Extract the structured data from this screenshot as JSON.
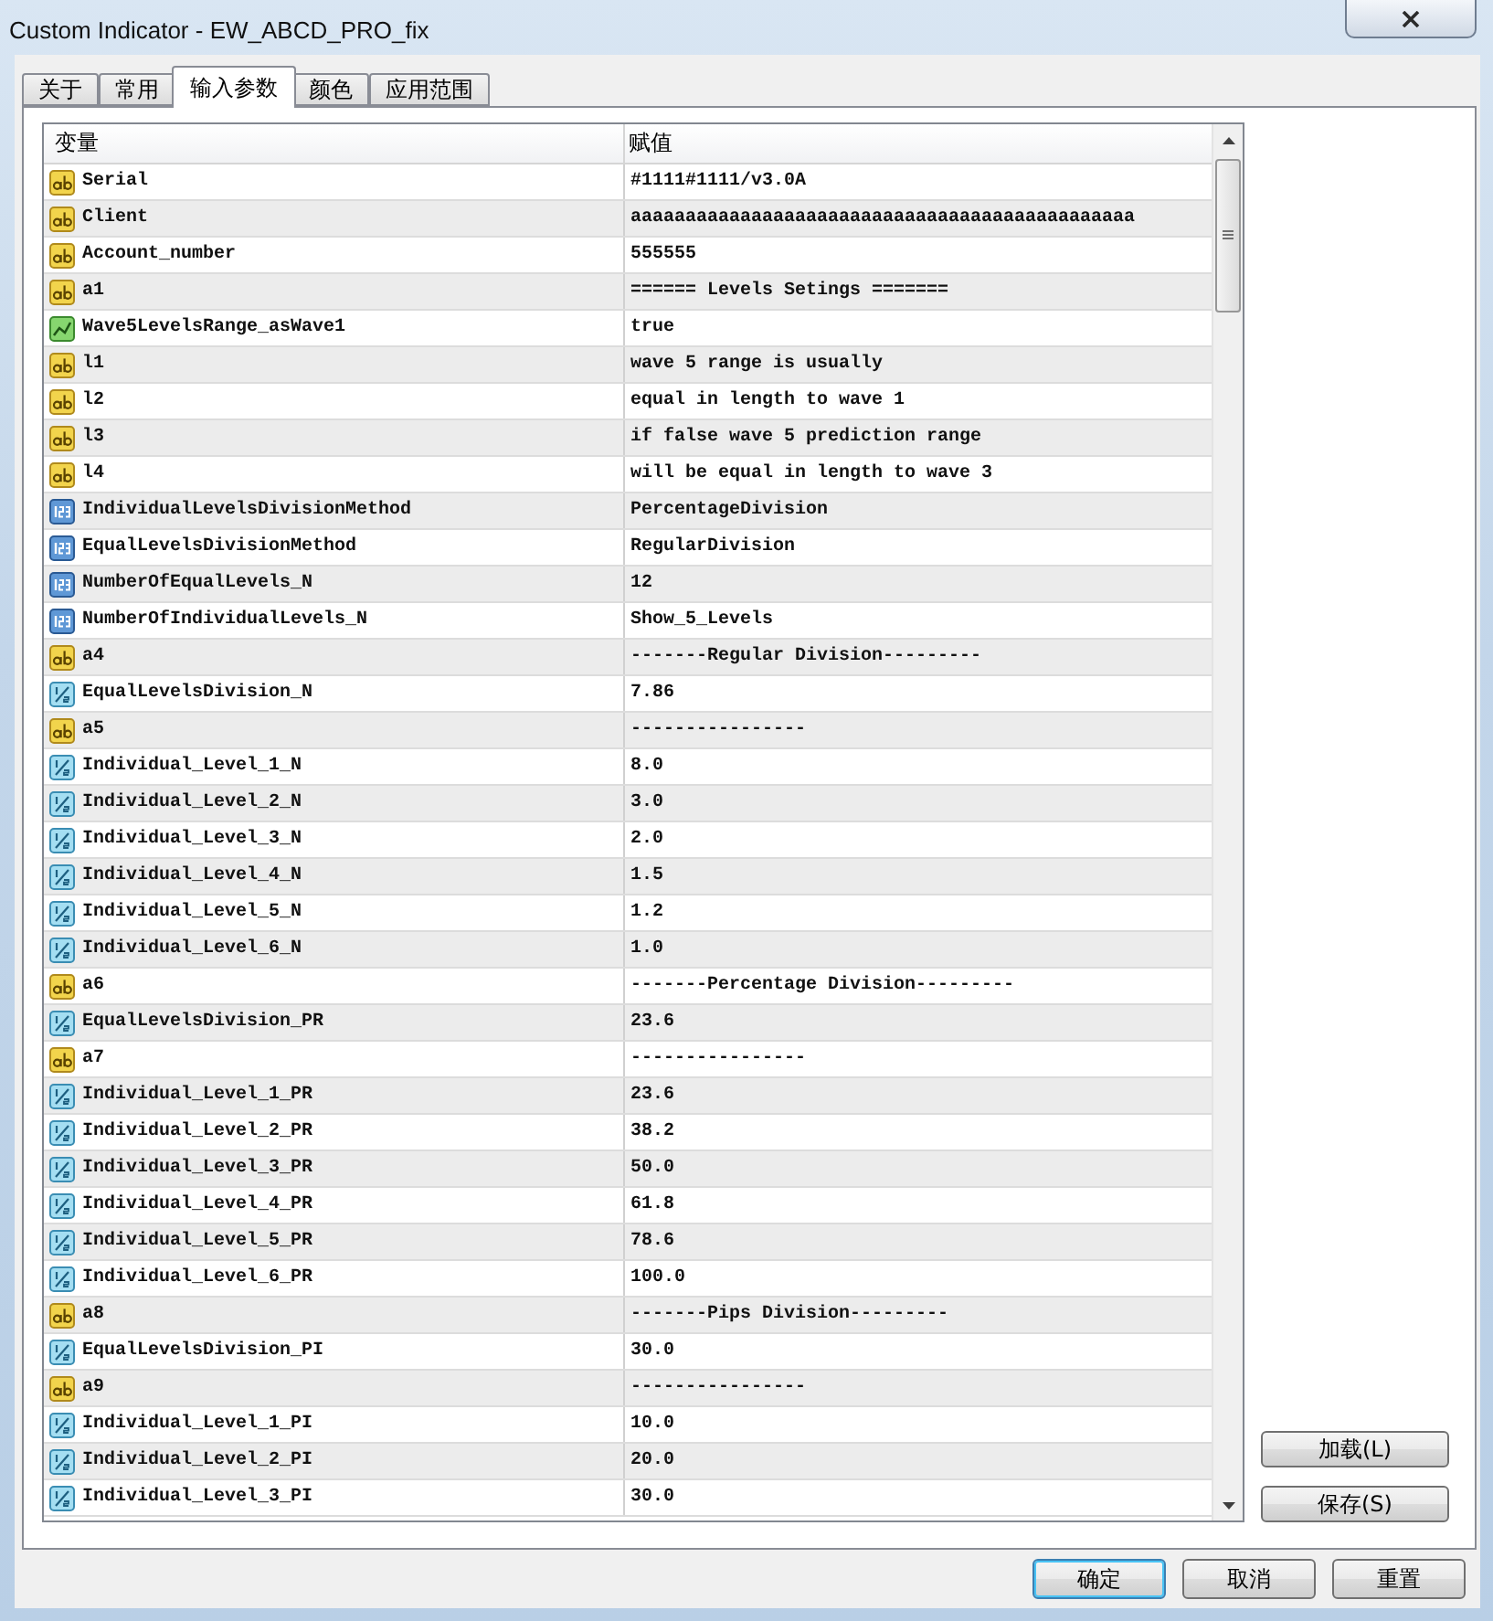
{
  "window": {
    "title": "Custom Indicator - EW_ABCD_PRO_fix"
  },
  "tabs": [
    {
      "label": "关于",
      "selected": false
    },
    {
      "label": "常用",
      "selected": false
    },
    {
      "label": "输入参数",
      "selected": true
    },
    {
      "label": "颜色",
      "selected": false
    },
    {
      "label": "应用范围",
      "selected": false
    }
  ],
  "table": {
    "columns": [
      "变量",
      "赋值"
    ],
    "rows": [
      {
        "kind": "string",
        "variable": "Serial",
        "value": "#1111#1111/v3.0A"
      },
      {
        "kind": "string",
        "variable": "Client",
        "value": "aaaaaaaaaaaaaaaaaaaaaaaaaaaaaaaaaaaaaaaaaaaaaa"
      },
      {
        "kind": "string",
        "variable": "Account_number",
        "value": "555555"
      },
      {
        "kind": "string",
        "variable": "a1",
        "value": "====== Levels Setings ======="
      },
      {
        "kind": "bool",
        "variable": "Wave5LevelsRange_asWave1",
        "value": "true"
      },
      {
        "kind": "string",
        "variable": "l1",
        "value": "wave 5 range is usually"
      },
      {
        "kind": "string",
        "variable": "l2",
        "value": "equal in length to wave 1"
      },
      {
        "kind": "string",
        "variable": "l3",
        "value": "if false wave 5 prediction range"
      },
      {
        "kind": "string",
        "variable": "l4",
        "value": "will be equal in length to wave 3"
      },
      {
        "kind": "int",
        "variable": "IndividualLevelsDivisionMethod",
        "value": "PercentageDivision"
      },
      {
        "kind": "int",
        "variable": "EqualLevelsDivisionMethod",
        "value": "RegularDivision"
      },
      {
        "kind": "int",
        "variable": "NumberOfEqualLevels_N",
        "value": "12"
      },
      {
        "kind": "int",
        "variable": "NumberOfIndividualLevels_N",
        "value": "Show_5_Levels"
      },
      {
        "kind": "string",
        "variable": "a4",
        "value": "-------Regular Division---------"
      },
      {
        "kind": "double",
        "variable": "EqualLevelsDivision_N",
        "value": "7.86"
      },
      {
        "kind": "string",
        "variable": "a5",
        "value": "----------------"
      },
      {
        "kind": "double",
        "variable": "Individual_Level_1_N",
        "value": "8.0"
      },
      {
        "kind": "double",
        "variable": "Individual_Level_2_N",
        "value": "3.0"
      },
      {
        "kind": "double",
        "variable": "Individual_Level_3_N",
        "value": "2.0"
      },
      {
        "kind": "double",
        "variable": "Individual_Level_4_N",
        "value": "1.5"
      },
      {
        "kind": "double",
        "variable": "Individual_Level_5_N",
        "value": "1.2"
      },
      {
        "kind": "double",
        "variable": "Individual_Level_6_N",
        "value": "1.0"
      },
      {
        "kind": "string",
        "variable": "a6",
        "value": "-------Percentage Division---------"
      },
      {
        "kind": "double",
        "variable": "EqualLevelsDivision_PR",
        "value": "23.6"
      },
      {
        "kind": "string",
        "variable": "a7",
        "value": "----------------"
      },
      {
        "kind": "double",
        "variable": "Individual_Level_1_PR",
        "value": "23.6"
      },
      {
        "kind": "double",
        "variable": "Individual_Level_2_PR",
        "value": "38.2"
      },
      {
        "kind": "double",
        "variable": "Individual_Level_3_PR",
        "value": "50.0"
      },
      {
        "kind": "double",
        "variable": "Individual_Level_4_PR",
        "value": "61.8"
      },
      {
        "kind": "double",
        "variable": "Individual_Level_5_PR",
        "value": "78.6"
      },
      {
        "kind": "double",
        "variable": "Individual_Level_6_PR",
        "value": "100.0"
      },
      {
        "kind": "string",
        "variable": "a8",
        "value": "-------Pips Division---------"
      },
      {
        "kind": "double",
        "variable": "EqualLevelsDivision_PI",
        "value": "30.0"
      },
      {
        "kind": "string",
        "variable": "a9",
        "value": "----------------"
      },
      {
        "kind": "double",
        "variable": "Individual_Level_1_PI",
        "value": "10.0"
      },
      {
        "kind": "double",
        "variable": "Individual_Level_2_PI",
        "value": "20.0"
      },
      {
        "kind": "double",
        "variable": "Individual_Level_3_PI",
        "value": "30.0"
      }
    ]
  },
  "side_buttons": [
    "加载(L)",
    "保存(S)"
  ],
  "buttons": [
    {
      "label": "确定",
      "default": true
    },
    {
      "label": "取消",
      "default": false
    },
    {
      "label": "重置",
      "default": false
    }
  ]
}
